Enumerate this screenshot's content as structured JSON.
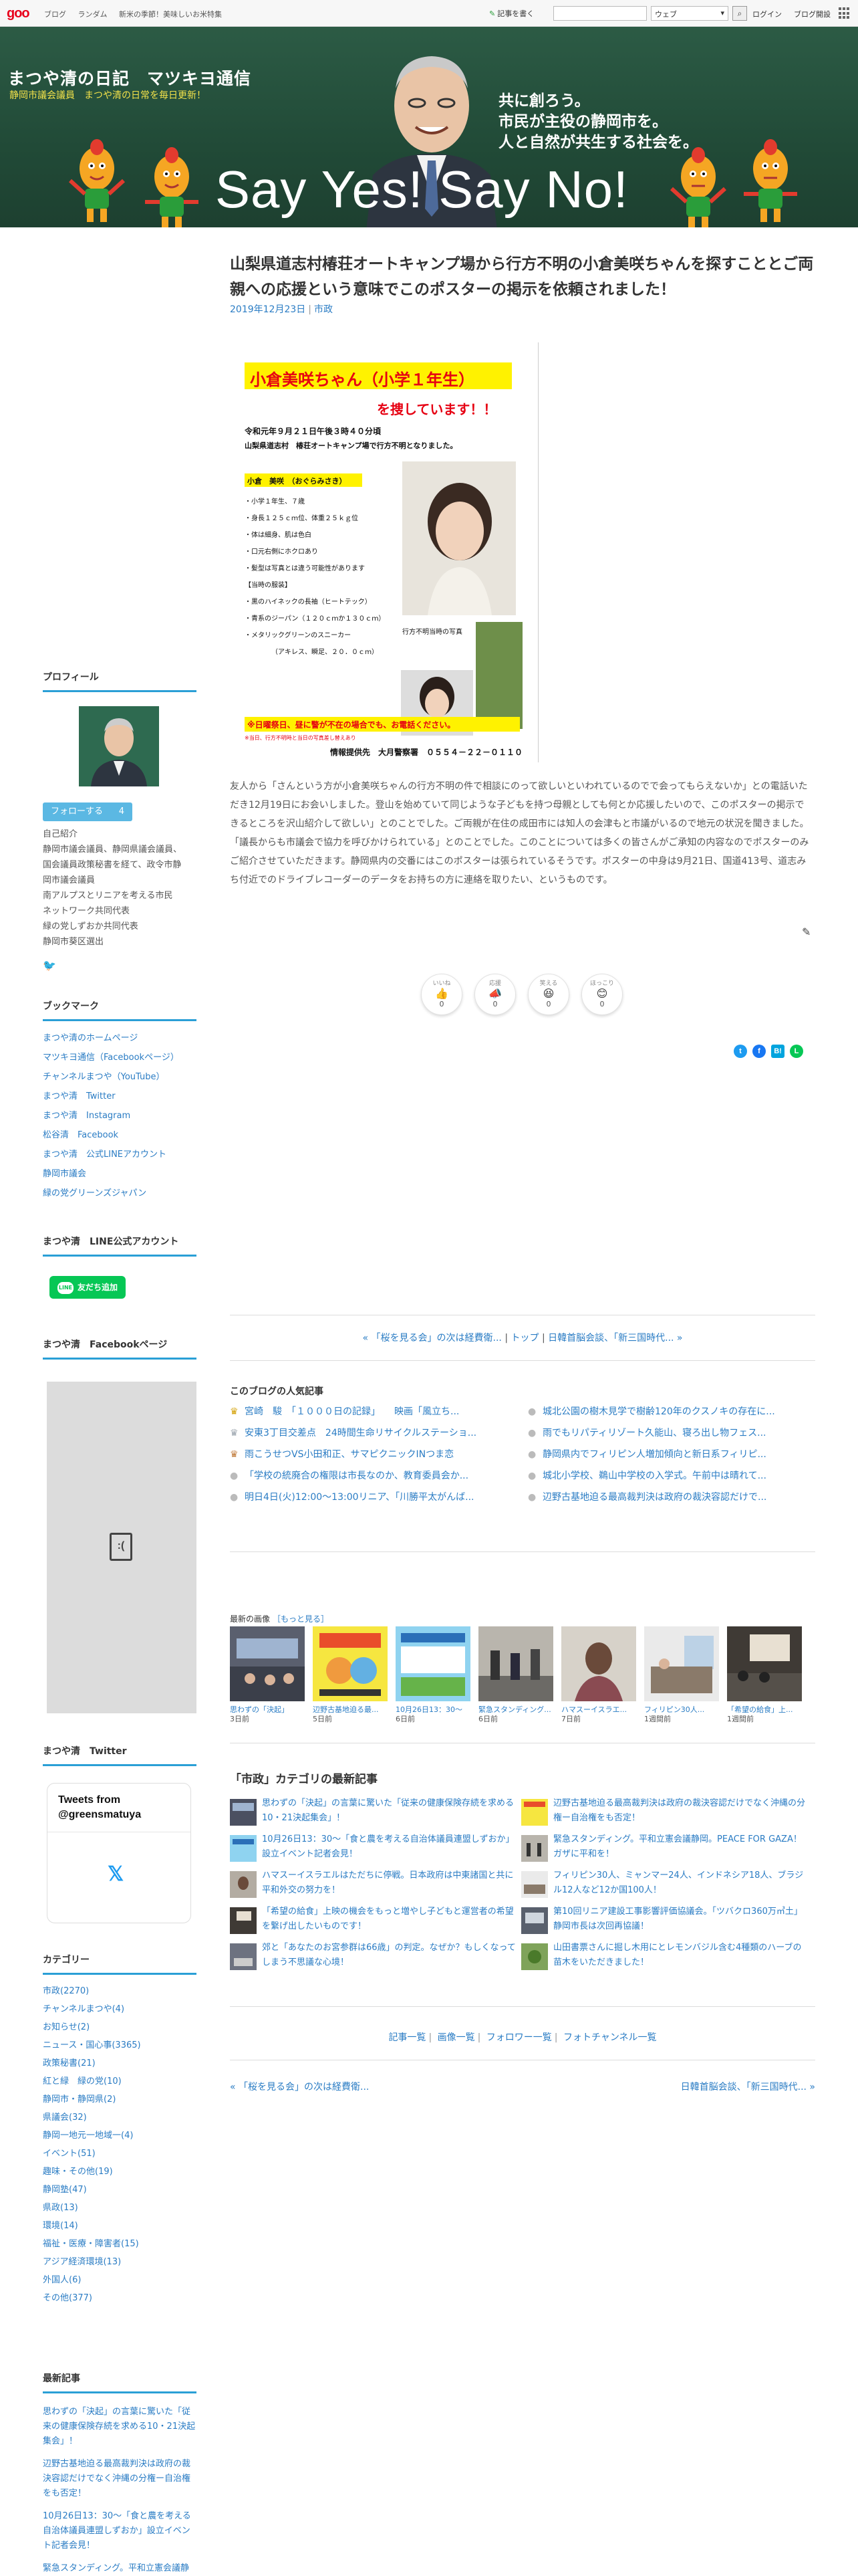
{
  "topbar": {
    "logo": "goo",
    "nav": [
      "ブログ",
      "ランダム",
      "新米の季節！美味しいお米特集"
    ],
    "write_label": "記事を書く",
    "search_value": "",
    "search_scope": "ウェブ",
    "login_label": "ログイン",
    "help_label": "ブログ開設"
  },
  "banner": {
    "title": "まつや清の日記　マツキヨ通信",
    "description": "静岡市議会議員　まつや清の日常を毎日更新！",
    "slogan": [
      "共に創ろう。",
      "市民が主役の静岡市を。",
      "人と自然が共生する社会を。"
    ],
    "big_text": "Say Yes! Say No!"
  },
  "article": {
    "title": "山梨県道志村椿荘オートキャンプ場から行方不明の小倉美咲ちゃんを探すこととご両親への応援という意味でこのポスターの掲示を依頼されました！",
    "date": "2019年12月23日",
    "category": "市政",
    "poster": {
      "name": "小倉美咲ちゃん（小学１年生）",
      "searching": "を捜しています！！",
      "line1": "令和元年９月２１日午後３時４０分頃",
      "line2": "山梨県道志村　椿荘オートキャンプ場で行方不明となりました。",
      "name_tag": "小倉　美咲　（おぐらみさき）",
      "details": [
        "・小学１年生、７歳",
        "・身長１２５ｃｍ位、体重２５ｋｇ位",
        "・体は細身、肌は色白",
        "・口元右側にホクロあり",
        "・髪型は写真とは違う可能性があります",
        "【当時の服装】",
        "・黒のハイネックの長袖（ヒートテック）",
        "・青系のジーパン（１２０ｃｍか１３０ｃｍ）",
        "・メタリックグリーンのスニーカー",
        "（アキレス、瞬足、２０．０ｃｍ）"
      ],
      "photo_note": "行方不明当時の写真",
      "notice": "※日曜祭日、昼に警が不在の場合でも、お電話ください。",
      "small_note": "※当日、行方不明時と当日の写真差し替えあり",
      "contact": "情報提供先　大月警察署　０５５４－２２－０１１０"
    },
    "body": "友人から「さんという方が小倉美咲ちゃんの行方不明の件で相談にのって欲しいといわれているのでで会ってもらえないか」との電話いただき12月19日にお会いしました。登山を始めていて同じような子どもを持つ母親としても何とか応援したいので、このポスターの掲示できるところを沢山紹介して欲しい」とのことでした。ご両親が在住の成田市には知人の会津もと市議がいるので地元の状況を聞きました。「議長からも市議会で協力を呼びかけられている」とのことでした。このことについては多くの皆さんがご承知の内容なのでポスターのみご紹介させていただきます。静岡県内の交番にはこのポスターは張られているそうです。ポスターの中身は9月21日、国道413号、道志みち付近でのドライブレコーダーのデータをお持ちの方に連絡を取りたい、というものです。",
    "reactions": [
      {
        "label": "いいね",
        "emoji": "👍",
        "count": "0"
      },
      {
        "label": "応援",
        "emoji": "📣",
        "count": "0"
      },
      {
        "label": "笑える",
        "emoji": "😆",
        "count": "0"
      },
      {
        "label": "ほっこり",
        "emoji": "😊",
        "count": "0"
      }
    ],
    "share": [
      "twitter-share",
      "facebook-share",
      "hatena-share",
      "line-share"
    ]
  },
  "pager_top": {
    "prev": "« 「桜を見る会」の次は経費衛...",
    "top": "トップ",
    "next": "日韓首脳会談、「新三国時代... »"
  },
  "popular": {
    "title": "このブログの人気記事",
    "left": [
      "宮崎　駿　「１０００日の記録」　　映画「風立ち...",
      "安東3丁目交差点　24時間生命リサイクルステーショ...",
      "雨こうせつVS小田和正、サマピクニックINつま恋",
      "「学校の統廃合の権限は市長なのか、教育委員会か...",
      "明日4日(火)12:00～13:00リニア、「川勝平太がんば..."
    ],
    "right": [
      "城北公園の樹木見学で樹齢120年のクスノキの存在に...",
      "雨でもリパティリゾート久能山、寝ろ出し物フェス...",
      "静岡県内でフィリピン人増加傾向と新日系フィリピ...",
      "城北小学校、鵜山中学校の入学式。午前中は晴れて...",
      "辺野古基地迫る最高裁判決は政府の裁決容認だけで..."
    ]
  },
  "recent_images": {
    "title": "最新の画像",
    "more": "［もっと見る］",
    "items": [
      {
        "caption": "思わずの「決起」",
        "date": "3日前"
      },
      {
        "caption": "辺野古基地迫る最...",
        "date": "5日前"
      },
      {
        "caption": "10月26日13：30～",
        "date": "6日前"
      },
      {
        "caption": "緊急スタンディング...",
        "date": "6日前"
      },
      {
        "caption": "ハマスーイスラエ...",
        "date": "7日前"
      },
      {
        "caption": "フィリピン30人...",
        "date": "1週間前"
      },
      {
        "caption": "「希望の給食」上...",
        "date": "1週間前"
      }
    ]
  },
  "category_latest": {
    "title": "「市政」カテゴリの最新記事",
    "left": [
      "思わずの「決起」の言葉に驚いた「従来の健康保険存続を求める10・21決起集会」！",
      "10月26日13：30～「食と農を考える自治体議員連盟しずおか」設立イベント記者会見！",
      "ハマスーイスラエルはただちに停戦。日本政府は中東諸国と共に平和外交の努力を！",
      "「希望の給食」上映の機会をもっと増やし子どもと運営者の希望を繋げ出したいものです！",
      "郊と「あなたのお宮参群は66歳」の判定。なぜか？もしくなってしまう不思議な心境！"
    ],
    "right": [
      "辺野古基地迫る最高裁判決は政府の裁決容認だけでなく沖縄の分権ー自治権をも否定！",
      "緊急スタンディング。平和立憲会議静岡。PEACE FOR GAZA！ガザに平和を！",
      "フィリピン30人、ミャンマー24人、インドネシア18人、ブラジル12人など12か国100人！",
      "第10回リニア建設工事影響評価協議会。「ツバクロ360万㎥土」静岡市長は次回再協議！",
      "山田書票さんに掘し木用にとレモンバジル含む4種類のハーブの苗木をいただきました！"
    ]
  },
  "bottom_links": [
    "記事一覧",
    "画像一覧",
    "フォロワー一覧",
    "フォトチャンネル一覧"
  ],
  "bottom_pager": {
    "prev": "« 「桜を見る会」の次は経費衛...",
    "next": "日韓首脳会談、「新三国時代... »"
  },
  "sidebar": {
    "profile_title": "プロフィール",
    "follow_label": "フォローする",
    "follow_count": "4",
    "profile_lines": [
      "自己紹介",
      "静岡市議会議員、静岡県議会議員、",
      "国会議員政策秘書を経て、政令市静",
      "岡市議会議員",
      "南アルプスとリニアを考える市民",
      "ネットワーク共同代表",
      "緑の党しずおか共同代表",
      "静岡市葵区選出"
    ],
    "bookmark_title": "ブックマーク",
    "bookmarks": [
      "まつや清のホームページ",
      "マツキヨ通信（Facebookページ）",
      "チャンネルまつや（YouTube）",
      "まつや清　Twitter",
      "まつや清　Instagram",
      "松谷清　Facebook",
      "まつや清　公式LINEアカウント",
      "静岡市議会",
      "緑の党グリーンズジャパン"
    ],
    "line_title": "まつや清　LINE公式アカウント",
    "line_btn": "友だち追加",
    "line_btn_icon": "LINE",
    "fb_title": "まつや清　Facebookページ",
    "twitter_title": "まつや清　Twitter",
    "tweets_from": "Tweets from @greensmatuya",
    "category_title": "カテゴリー",
    "categories": [
      "市政(2270)",
      "チャンネルまつや(4)",
      "お知らせ(2)",
      "ニュース・国心事(3365)",
      "政策秘書(21)",
      "紅と緑　緑の党(10)",
      "静岡市・静岡県(2)",
      "県議会(32)",
      "静岡一地元一地域一(4)",
      "イベント(51)",
      "趣味・その他(19)",
      "静岡塾(47)",
      "県政(13)",
      "環境(14)",
      "福祉・医療・障害者(15)",
      "アジア経済環境(13)",
      "外国人(6)",
      "その他(377)"
    ],
    "latest_title": "最新記事",
    "latest": [
      "思わずの「決起」の言葉に驚いた「従来の健康保険存続を求める10・21決起集会」！",
      "辺野古基地迫る最高裁判決は政府の裁決容認だけでなく沖縄の分権ー自治権をも否定！",
      "10月26日13：30～「食と農を考える自治体議員連盟しずおか」設立イベント記者会見！",
      "緊急スタンディング。平和立憲会議静岡。PEACE FOR GAZA！ガザに平和を！"
    ]
  },
  "colors": {
    "banner": "#214a37",
    "link": "#2a7cc4",
    "accent": "#2a9fd6",
    "follow": "#5bb8e3",
    "line": "#06c755"
  }
}
